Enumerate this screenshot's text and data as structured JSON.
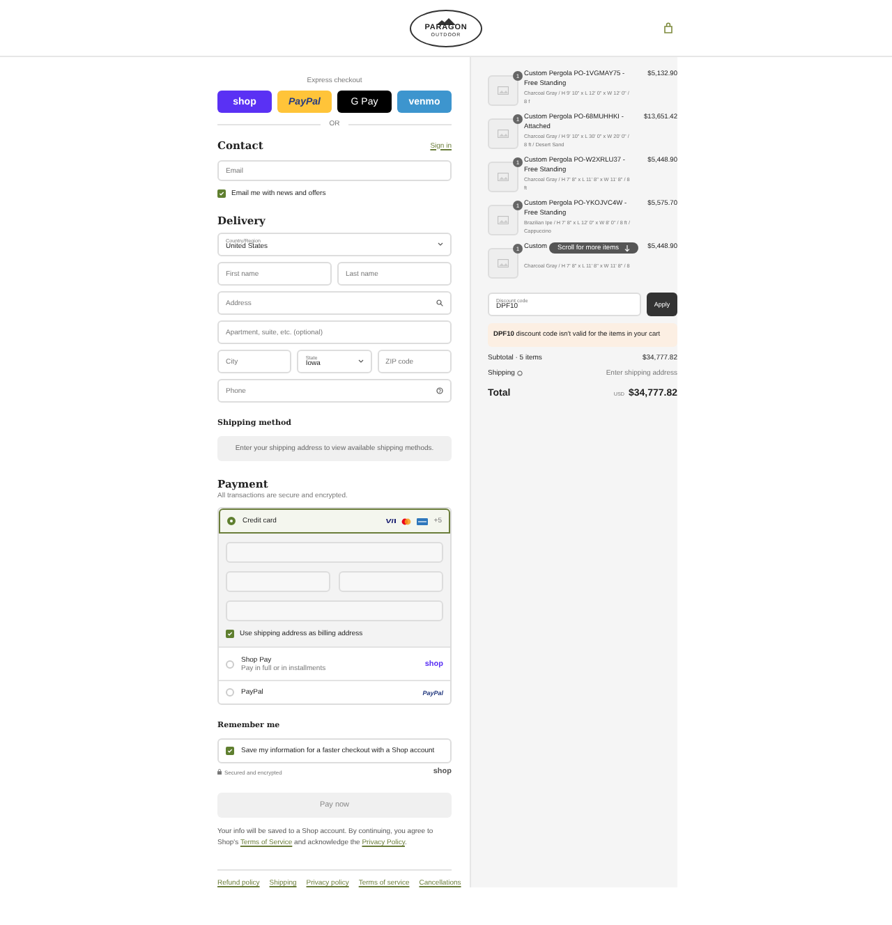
{
  "header": {
    "logo_name": "PARAGON",
    "logo_sub": "OUTDOOR"
  },
  "express": {
    "label": "Express checkout",
    "divider": "OR",
    "buttons": [
      {
        "kind": "shop",
        "label": "shop"
      },
      {
        "kind": "paypal",
        "label": "PayPal"
      },
      {
        "kind": "gpay",
        "label": "G Pay"
      },
      {
        "kind": "venmo",
        "label": "venmo"
      }
    ]
  },
  "contact": {
    "heading": "Contact",
    "sign_in": "Sign in",
    "email": {
      "placeholder": "Email"
    },
    "news": {
      "label": "Email me with news and offers",
      "checked": true
    }
  },
  "delivery": {
    "heading": "Delivery",
    "rows": [
      [
        {
          "kind": "select",
          "label": "Country/Region",
          "value": "United States"
        }
      ],
      [
        {
          "kind": "input",
          "placeholder": "First name"
        },
        {
          "kind": "input",
          "placeholder": "Last name"
        }
      ],
      [
        {
          "kind": "search",
          "placeholder": "Address"
        }
      ],
      [
        {
          "kind": "input",
          "placeholder": "Apartment, suite, etc. (optional)"
        }
      ],
      [
        {
          "kind": "input",
          "placeholder": "City"
        },
        {
          "kind": "select",
          "label": "State",
          "value": "Iowa"
        },
        {
          "kind": "input",
          "placeholder": "ZIP code"
        }
      ],
      [
        {
          "kind": "help",
          "placeholder": "Phone"
        }
      ]
    ]
  },
  "shipping_method": {
    "heading": "Shipping method",
    "message": "Enter your shipping address to view available shipping methods."
  },
  "payment": {
    "heading": "Payment",
    "subtitle": "All transactions are secure and encrypted.",
    "methods": [
      {
        "kind": "card",
        "label": "Credit card",
        "selected": true,
        "more": "+5",
        "billing": {
          "label": "Use shipping address as billing address",
          "checked": true
        }
      },
      {
        "kind": "shoppay",
        "label": "Shop Pay",
        "sub": "Pay in full or in installments",
        "logo": "shop",
        "selected": false
      },
      {
        "kind": "paypal",
        "label": "PayPal",
        "logo": "PayPal",
        "selected": false
      }
    ]
  },
  "remember": {
    "heading": "Remember me",
    "save": {
      "label": "Save my information for a faster checkout with a Shop account",
      "checked": true
    },
    "secure": "Secured and encrypted",
    "logo": "shop"
  },
  "pay_button": {
    "label": "Pay now",
    "disabled": true
  },
  "legal": [
    {
      "kind": "text",
      "text": "Your info will be saved to a Shop account. By continuing, you agree to Shop's "
    },
    {
      "kind": "link",
      "text": "Terms of Service"
    },
    {
      "kind": "text",
      "text": " and acknowledge the "
    },
    {
      "kind": "link",
      "text": "Privacy Policy"
    },
    {
      "kind": "text",
      "text": "."
    }
  ],
  "footer_links": [
    "Refund policy",
    "Shipping",
    "Privacy policy",
    "Terms of service",
    "Cancellations"
  ],
  "summary": {
    "items": [
      {
        "quantity": "1",
        "title": "Custom Pergola PO-1VGMAY75 - Free Standing",
        "variant": "Charcoal Gray / H 9' 10\" x L 12' 0\" x W 12' 0\" / 8 f",
        "price": "$5,132.90"
      },
      {
        "quantity": "1",
        "title": "Custom Pergola PO-68MUHHKI - Attached",
        "variant": "Charcoal Gray / H 9' 10\" x L 30' 0\" x W 20' 0\" / 8 ft / Desert Sand",
        "price": "$13,651.42"
      },
      {
        "quantity": "1",
        "title": "Custom Pergola PO-W2XRLU37 - Free Standing",
        "variant": "Charcoal Gray / H 7' 8\" x L 11' 8\" x W 11' 8\" / 8 ft",
        "price": "$5,448.90"
      },
      {
        "quantity": "1",
        "title": "Custom Pergola PO-YKOJVC4W - Free Standing",
        "variant": "Brazilian Ipe / H 7' 8\" x L 12' 0\" x W 8' 0\" / 8 ft / Cappuccino",
        "price": "$5,575.70"
      },
      {
        "quantity": "1",
        "title": "Custom",
        "variant": "Charcoal Gray / H 7' 8\" x L 11' 8\" x W 11' 8\" / 8",
        "price": "$5,448.90"
      }
    ],
    "scroll_hint": "Scroll for more items",
    "discount": {
      "label": "Discount code",
      "value": "DPF10",
      "button": "Apply"
    },
    "warning": "**DPF10** discount code isn't valid for the items in your cart",
    "lines": [
      {
        "label": "Subtotal · 5 items",
        "value": "$34,777.82"
      },
      {
        "label": "Shipping",
        "value": "Enter shipping address"
      }
    ],
    "total": {
      "label": "Total",
      "currency": "USD",
      "value": "$34,777.82"
    }
  }
}
